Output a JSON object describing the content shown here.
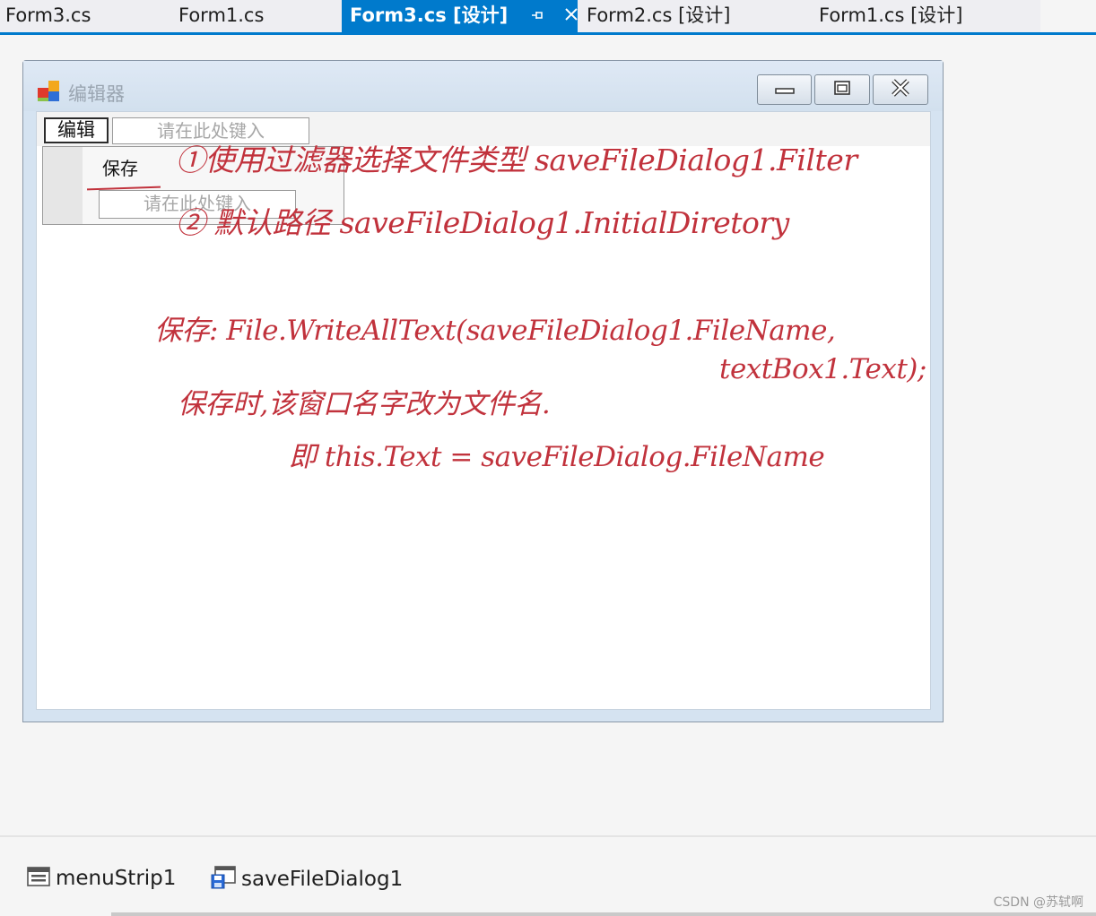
{
  "colors": {
    "accent": "#007acc",
    "annotation": "#c1323c"
  },
  "tabs": [
    {
      "label": "Form3.cs",
      "active": false
    },
    {
      "label": "Form1.cs",
      "active": false
    },
    {
      "label": "Form3.cs [设计]",
      "active": true
    },
    {
      "label": "Form2.cs [设计]",
      "active": false
    },
    {
      "label": "Form1.cs [设计]",
      "active": false
    }
  ],
  "tab_icons": {
    "pin": "pin-icon",
    "close": "close-icon"
  },
  "form": {
    "title": "编辑器",
    "icon": "form-app-icon",
    "menu": {
      "top_item": "编辑",
      "type_here": "请在此处键入",
      "dropdown_item": "保存",
      "dropdown_type_here": "请在此处键入"
    },
    "caption_buttons": [
      "minimize-icon",
      "maximize-icon",
      "close-icon"
    ]
  },
  "annotations": {
    "line1": "①使用过滤器选择文件类型 saveFileDialog1.Filter",
    "line2": "② 默认路径 saveFileDialog1.InitialDiretory",
    "line3": "保存: File.WriteAllText(saveFileDialog1.FileName,",
    "line4": "textBox1.Text);",
    "line5": "保存时,该窗口名字改为文件名.",
    "line6": "即 this.Text = saveFileDialog.FileName"
  },
  "tray": {
    "items": [
      {
        "label": "menuStrip1",
        "icon": "menustrip-icon"
      },
      {
        "label": "saveFileDialog1",
        "icon": "savefiledialog-icon"
      }
    ]
  },
  "watermark": "CSDN @苏轼啊"
}
